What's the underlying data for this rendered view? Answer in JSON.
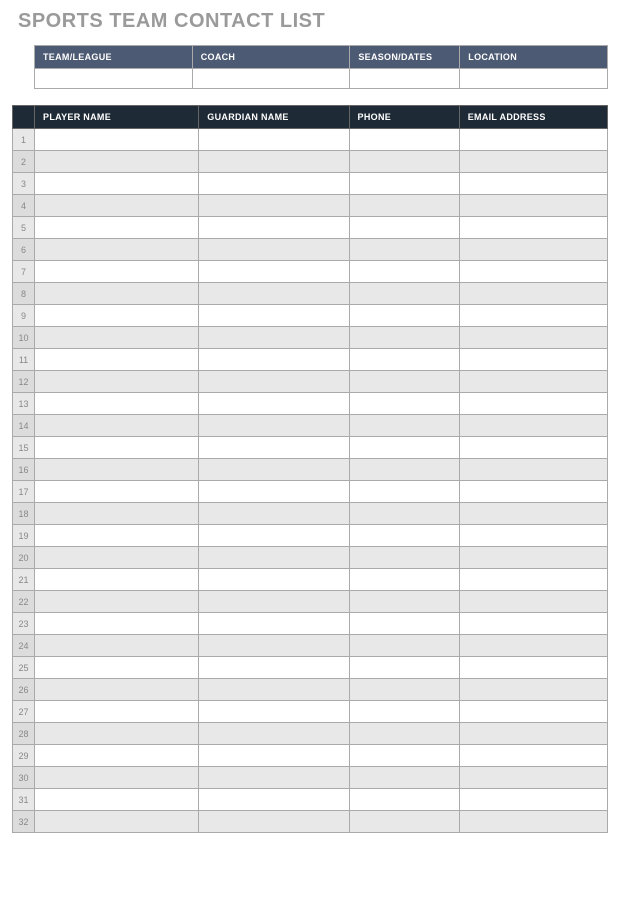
{
  "title": "SPORTS TEAM CONTACT LIST",
  "info_headers": {
    "team": "TEAM/LEAGUE",
    "coach": "COACH",
    "season": "SEASON/DATES",
    "location": "LOCATION"
  },
  "info_values": {
    "team": "",
    "coach": "",
    "season": "",
    "location": ""
  },
  "player_headers": {
    "num": "",
    "player": "PLAYER NAME",
    "guardian": "GUARDIAN NAME",
    "phone": "PHONE",
    "email": "EMAIL ADDRESS"
  },
  "rows": [
    {
      "num": "1",
      "player": "",
      "guardian": "",
      "phone": "",
      "email": ""
    },
    {
      "num": "2",
      "player": "",
      "guardian": "",
      "phone": "",
      "email": ""
    },
    {
      "num": "3",
      "player": "",
      "guardian": "",
      "phone": "",
      "email": ""
    },
    {
      "num": "4",
      "player": "",
      "guardian": "",
      "phone": "",
      "email": ""
    },
    {
      "num": "5",
      "player": "",
      "guardian": "",
      "phone": "",
      "email": ""
    },
    {
      "num": "6",
      "player": "",
      "guardian": "",
      "phone": "",
      "email": ""
    },
    {
      "num": "7",
      "player": "",
      "guardian": "",
      "phone": "",
      "email": ""
    },
    {
      "num": "8",
      "player": "",
      "guardian": "",
      "phone": "",
      "email": ""
    },
    {
      "num": "9",
      "player": "",
      "guardian": "",
      "phone": "",
      "email": ""
    },
    {
      "num": "10",
      "player": "",
      "guardian": "",
      "phone": "",
      "email": ""
    },
    {
      "num": "11",
      "player": "",
      "guardian": "",
      "phone": "",
      "email": ""
    },
    {
      "num": "12",
      "player": "",
      "guardian": "",
      "phone": "",
      "email": ""
    },
    {
      "num": "13",
      "player": "",
      "guardian": "",
      "phone": "",
      "email": ""
    },
    {
      "num": "14",
      "player": "",
      "guardian": "",
      "phone": "",
      "email": ""
    },
    {
      "num": "15",
      "player": "",
      "guardian": "",
      "phone": "",
      "email": ""
    },
    {
      "num": "16",
      "player": "",
      "guardian": "",
      "phone": "",
      "email": ""
    },
    {
      "num": "17",
      "player": "",
      "guardian": "",
      "phone": "",
      "email": ""
    },
    {
      "num": "18",
      "player": "",
      "guardian": "",
      "phone": "",
      "email": ""
    },
    {
      "num": "19",
      "player": "",
      "guardian": "",
      "phone": "",
      "email": ""
    },
    {
      "num": "20",
      "player": "",
      "guardian": "",
      "phone": "",
      "email": ""
    },
    {
      "num": "21",
      "player": "",
      "guardian": "",
      "phone": "",
      "email": ""
    },
    {
      "num": "22",
      "player": "",
      "guardian": "",
      "phone": "",
      "email": ""
    },
    {
      "num": "23",
      "player": "",
      "guardian": "",
      "phone": "",
      "email": ""
    },
    {
      "num": "24",
      "player": "",
      "guardian": "",
      "phone": "",
      "email": ""
    },
    {
      "num": "25",
      "player": "",
      "guardian": "",
      "phone": "",
      "email": ""
    },
    {
      "num": "26",
      "player": "",
      "guardian": "",
      "phone": "",
      "email": ""
    },
    {
      "num": "27",
      "player": "",
      "guardian": "",
      "phone": "",
      "email": ""
    },
    {
      "num": "28",
      "player": "",
      "guardian": "",
      "phone": "",
      "email": ""
    },
    {
      "num": "29",
      "player": "",
      "guardian": "",
      "phone": "",
      "email": ""
    },
    {
      "num": "30",
      "player": "",
      "guardian": "",
      "phone": "",
      "email": ""
    },
    {
      "num": "31",
      "player": "",
      "guardian": "",
      "phone": "",
      "email": ""
    },
    {
      "num": "32",
      "player": "",
      "guardian": "",
      "phone": "",
      "email": ""
    }
  ]
}
